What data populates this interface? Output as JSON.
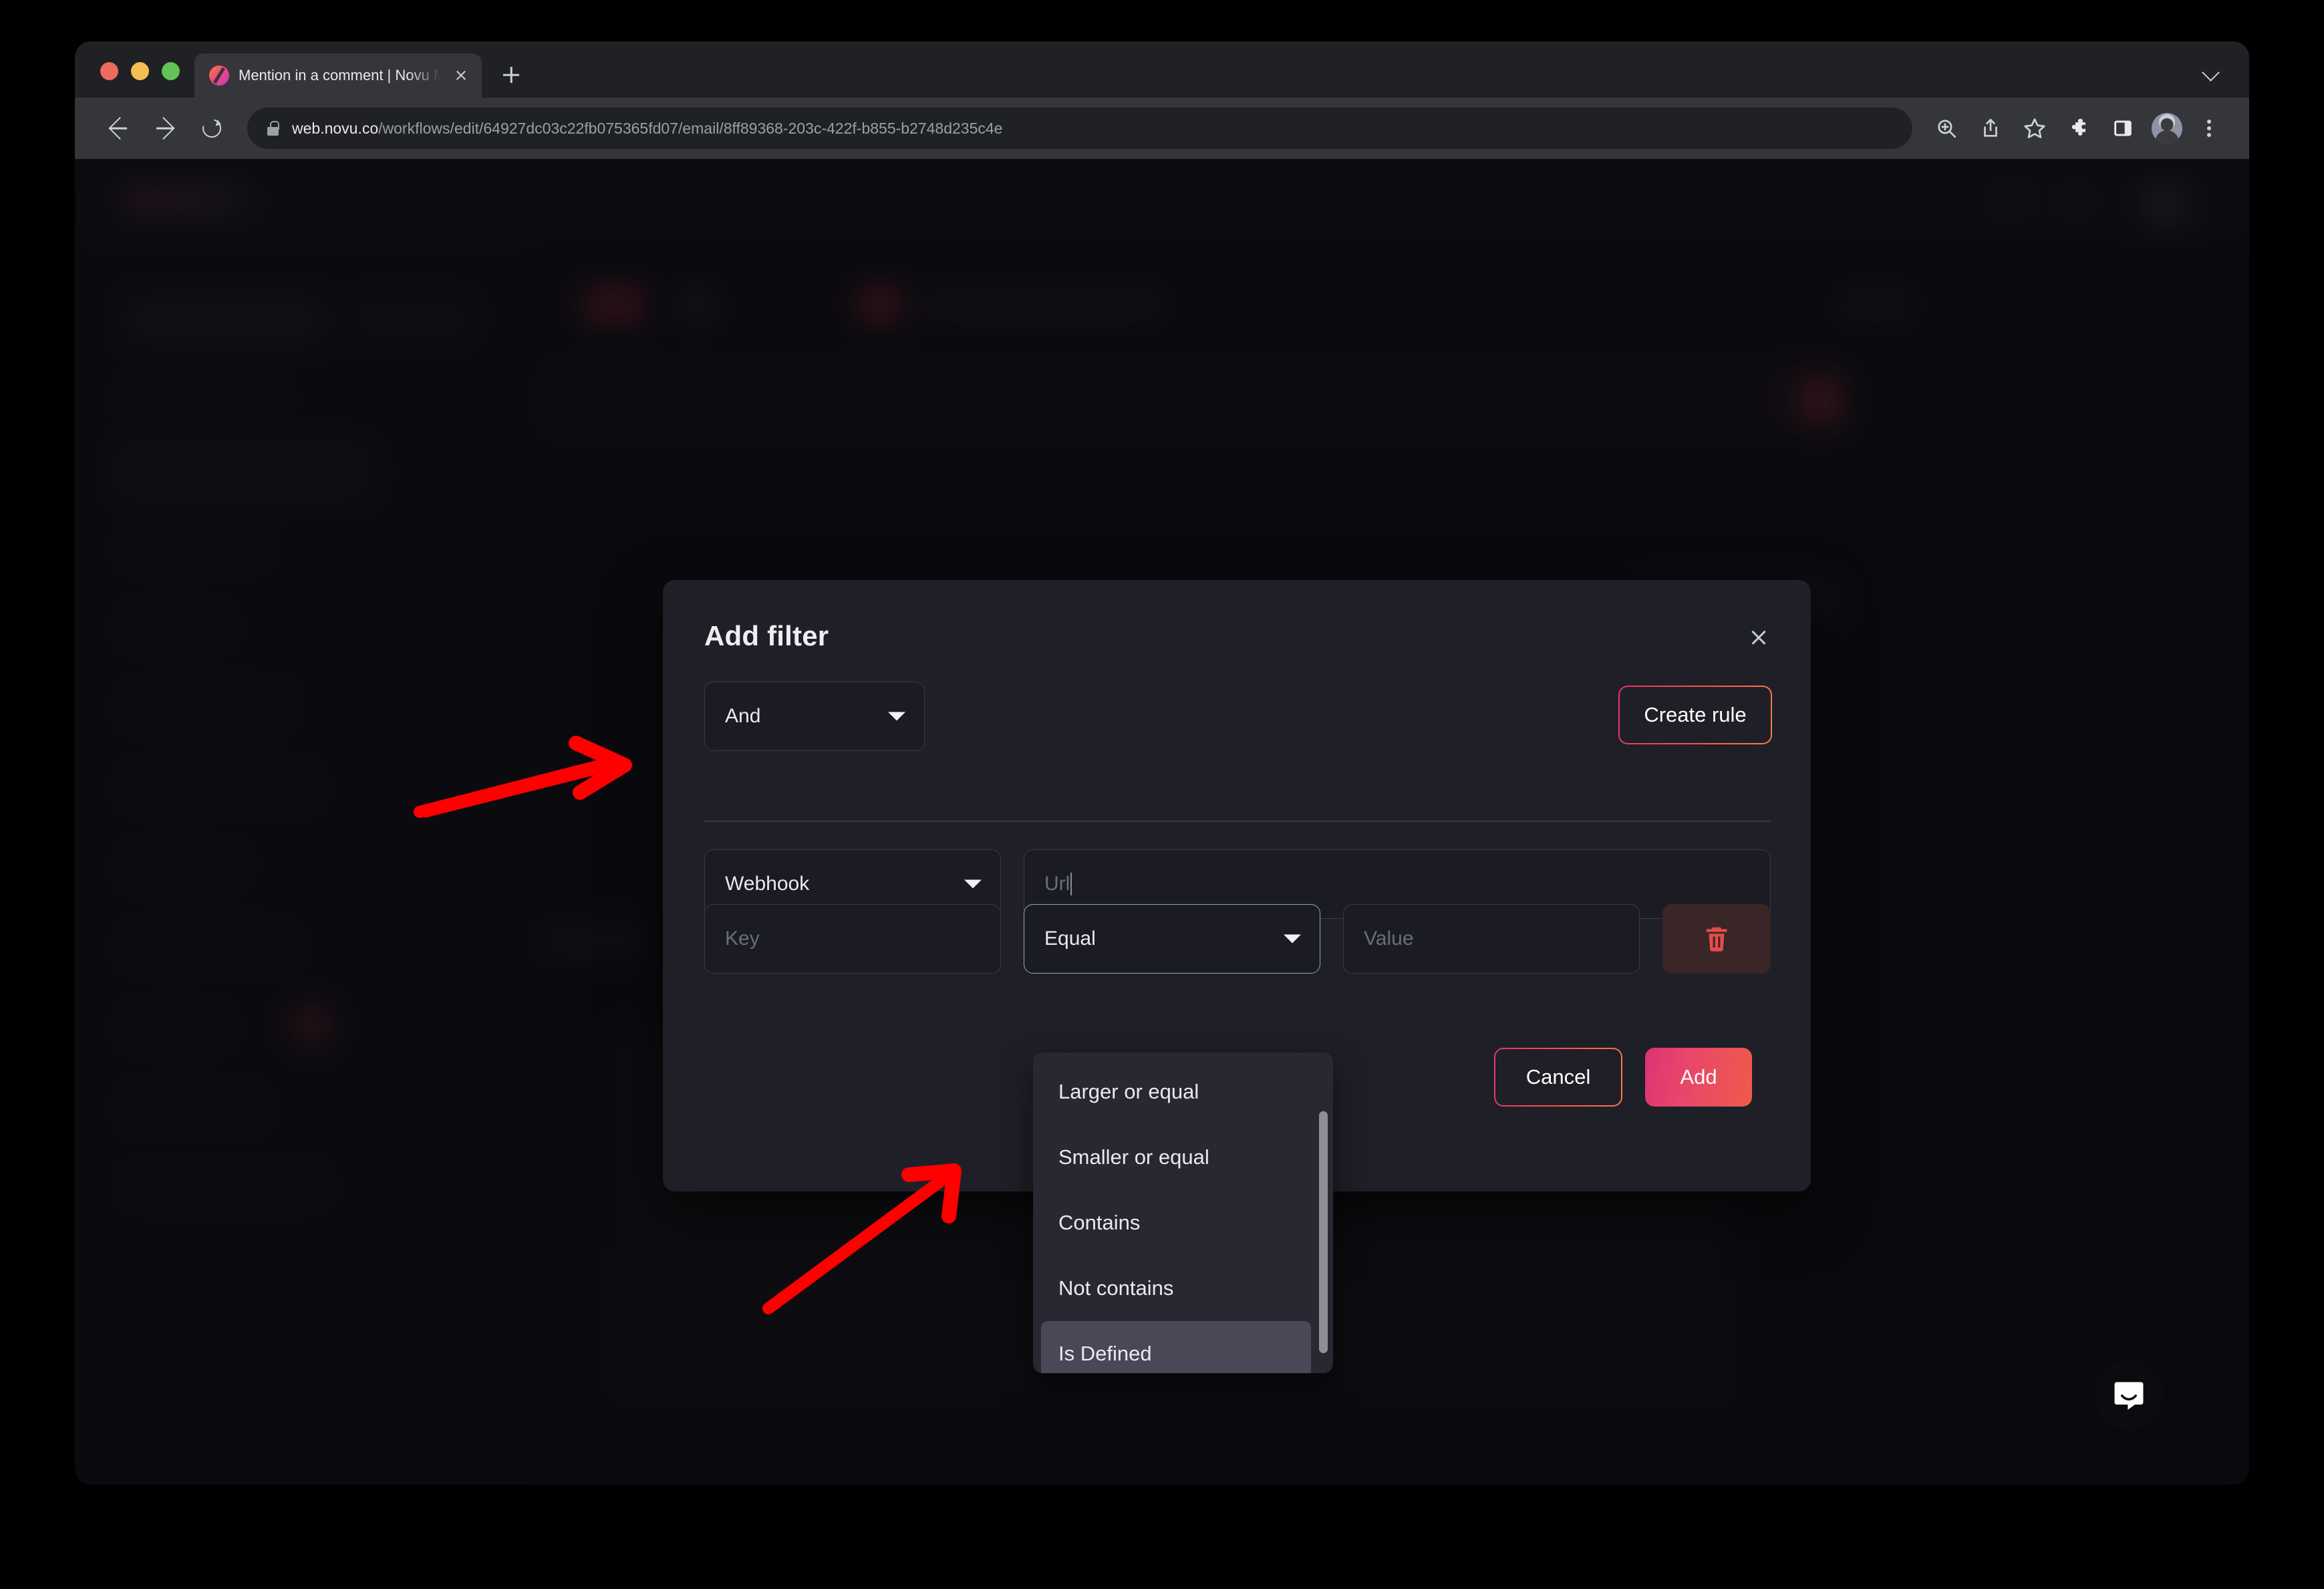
{
  "browser": {
    "tab": {
      "title": "Mention in a comment | Novu M",
      "favicon": "novu-logo-icon",
      "close": "close-tab-icon"
    },
    "new_tab": "new-tab-icon",
    "tab_list_chevron": "chevron-down-icon",
    "nav": {
      "back": "back-arrow-icon",
      "forward": "forward-arrow-icon",
      "reload": "reload-icon"
    },
    "address": {
      "lock": "lock-icon",
      "domain": "web.novu.co",
      "path": "/workflows/edit/64927dc03c22fb075365fd07/email/8ff89368-203c-422f-b855-b2748d235c4e"
    },
    "toolbar_icons": [
      "zoom-in-icon",
      "share-icon",
      "bookmark-star-icon",
      "extensions-puzzle-icon",
      "side-panel-icon",
      "profile-avatar",
      "browser-menu-icon"
    ]
  },
  "modal": {
    "title": "Add filter",
    "close_icon": "close-icon",
    "logic_operator": {
      "value": "And",
      "chevron": "chevron-down-icon"
    },
    "create_rule_label": "Create rule",
    "rule": {
      "source": {
        "value": "Webhook",
        "chevron": "chevron-down-icon"
      },
      "url": {
        "placeholder": "Url",
        "value": ""
      },
      "key": {
        "placeholder": "Key",
        "value": ""
      },
      "operator": {
        "value": "Equal",
        "chevron": "chevron-down-icon"
      },
      "field_value": {
        "placeholder": "Value",
        "value": ""
      },
      "delete_icon": "trash-icon"
    },
    "footer": {
      "cancel_label": "Cancel",
      "add_label": "Add"
    }
  },
  "operator_dropdown": {
    "options": [
      {
        "label": "Larger or equal",
        "selected": false
      },
      {
        "label": "Smaller or equal",
        "selected": false
      },
      {
        "label": "Contains",
        "selected": false
      },
      {
        "label": "Not contains",
        "selected": false
      },
      {
        "label": "Is Defined",
        "selected": true
      }
    ],
    "scrollbar": "vertical-scrollbar"
  },
  "annotations": [
    {
      "name": "arrow-to-source-dropdown",
      "color": "#FF0000"
    },
    {
      "name": "arrow-to-is-defined-option",
      "color": "#FF0000"
    }
  ],
  "support_widget": {
    "icon": "intercom-chat-icon"
  },
  "colors": {
    "accent_pink": "#dd3474",
    "accent_orange": "#ef5a4b",
    "danger": "#e54b4b",
    "modal_bg": "#1f1f27",
    "dropdown_bg": "#282832"
  }
}
